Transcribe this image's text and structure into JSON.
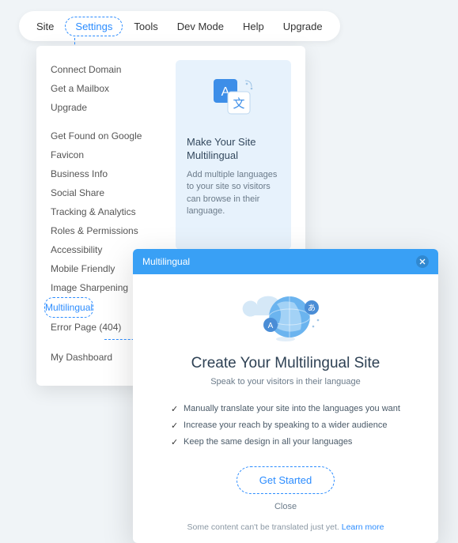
{
  "toolbar": {
    "items": [
      {
        "label": "Site"
      },
      {
        "label": "Settings",
        "highlighted": true
      },
      {
        "label": "Tools"
      },
      {
        "label": "Dev Mode"
      },
      {
        "label": "Help"
      },
      {
        "label": "Upgrade"
      }
    ]
  },
  "settings_menu": {
    "group1": [
      "Connect Domain",
      "Get a Mailbox",
      "Upgrade"
    ],
    "group2": [
      "Get Found on Google",
      "Favicon",
      "Business Info",
      "Social Share",
      "Tracking & Analytics",
      "Roles & Permissions",
      "Accessibility",
      "Mobile Friendly",
      "Image Sharpening",
      "Multilingual",
      "Error Page (404)"
    ],
    "group3": [
      "My Dashboard"
    ],
    "highlighted_item": "Multilingual"
  },
  "side_card": {
    "title": "Make Your Site Multilingual",
    "desc": "Add multiple languages to your site so visitors can browse in their language."
  },
  "modal": {
    "header_title": "Multilingual",
    "title": "Create Your Multilingual Site",
    "subtitle": "Speak to your visitors in their language",
    "bullets": [
      "Manually translate your site into the languages you want",
      "Increase your reach by speaking to a wider audience",
      "Keep the same design in all your languages"
    ],
    "cta": "Get Started",
    "close": "Close",
    "footnote_text": "Some content can't be translated just yet. ",
    "footnote_link": "Learn more"
  }
}
